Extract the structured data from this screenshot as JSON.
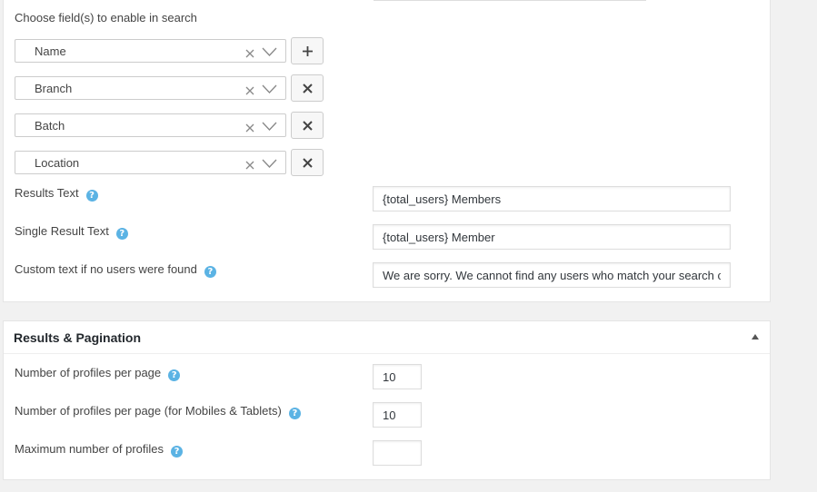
{
  "search_fields": {
    "label": "Choose field(s) to enable in search",
    "fields": [
      {
        "value": "Name",
        "action": "add"
      },
      {
        "value": "Branch",
        "action": "remove"
      },
      {
        "value": "Batch",
        "action": "remove"
      },
      {
        "value": "Location",
        "action": "remove"
      }
    ]
  },
  "results_text": {
    "label": "Results Text",
    "value": "{total_users} Members"
  },
  "single_result_text": {
    "label": "Single Result Text",
    "value": "{total_users} Member"
  },
  "no_users_text": {
    "label": "Custom text if no users were found",
    "value": "We are sorry. We cannot find any users who match your search cr"
  },
  "help_icon_glyph": "?",
  "results_pagination": {
    "title": "Results & Pagination",
    "profiles_per_page": {
      "label": "Number of profiles per page",
      "value": "10"
    },
    "profiles_per_page_mobile": {
      "label": "Number of profiles per page (for Mobiles & Tablets)",
      "value": "10"
    },
    "max_profiles": {
      "label": "Maximum number of profiles",
      "value": ""
    }
  },
  "colors": {
    "help_icon": "#5bb3e4",
    "panel_bg": "#ffffff",
    "page_bg": "#f1f1f1"
  }
}
